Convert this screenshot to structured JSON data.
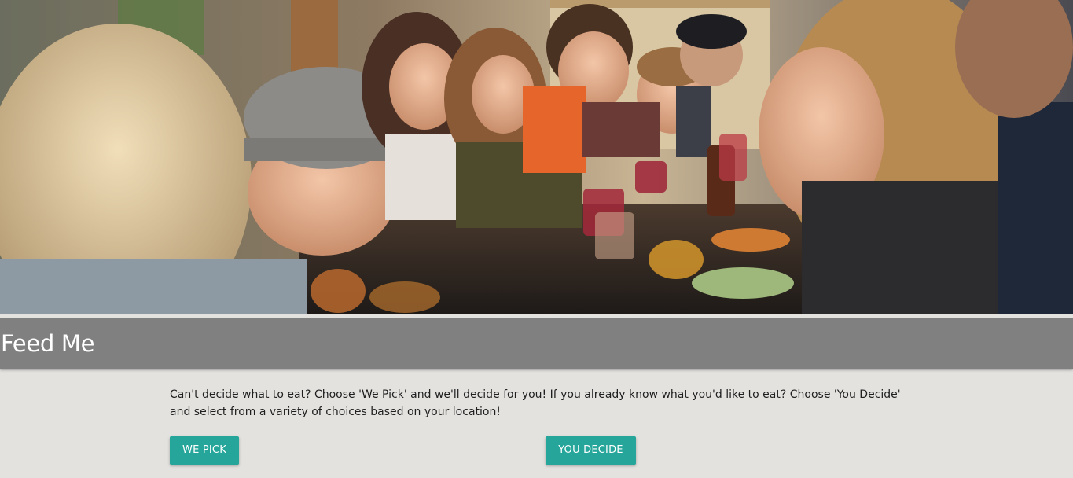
{
  "hero": {
    "image_description_icon": "group-dining-photo"
  },
  "navbar": {
    "brand": "Feed Me"
  },
  "main": {
    "intro_text": "Can't decide what to eat? Choose 'We Pick' and we'll decide for you! If you already know what you'd like to eat? Choose 'You Decide' and select from a variety of choices based on your location!",
    "buttons": {
      "we_pick": "We Pick",
      "you_decide": "You Decide"
    }
  },
  "colors": {
    "navbar": "#808080",
    "accent": "#26a69a",
    "background": "#e3e2df"
  }
}
